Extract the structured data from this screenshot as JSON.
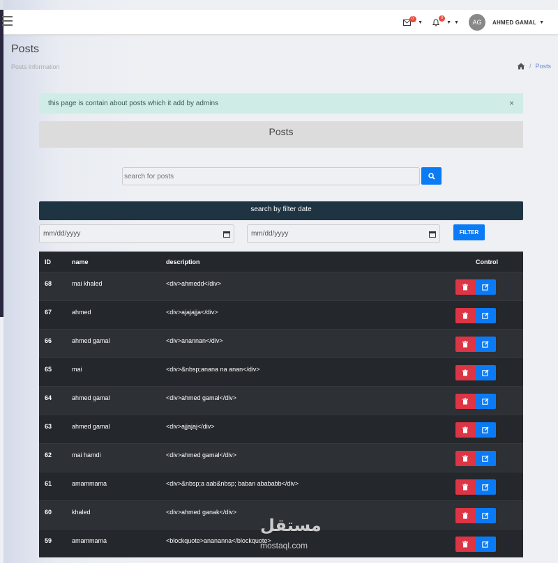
{
  "navbar": {
    "mail_badge": "0",
    "bell_badge": "0",
    "avatar_initials": "AG",
    "user_name": "AHMED GAMAL"
  },
  "page": {
    "title": "Posts",
    "subtitle": "Posts information",
    "breadcrumb_current": "Posts"
  },
  "alert": {
    "text": "this page is contain about posts which it add by admins",
    "close": "×"
  },
  "posts_header": "Posts",
  "search": {
    "placeholder": "search for posts"
  },
  "filter": {
    "bar_label": "search by filter date",
    "from_placeholder": "mm/dd/yyyy",
    "to_placeholder": "mm/dd/yyyy",
    "button_label": "FILTER"
  },
  "table": {
    "headers": {
      "id": "ID",
      "name": "name",
      "description": "description",
      "control": "Control"
    },
    "rows": [
      {
        "id": "68",
        "name": "mai khaled",
        "description": "<div>ahmedd</div>"
      },
      {
        "id": "67",
        "name": "ahmed",
        "description": "<div>ajajajja</div>"
      },
      {
        "id": "66",
        "name": "ahmed gamal",
        "description": "<div>anannan</div>"
      },
      {
        "id": "65",
        "name": "mai",
        "description": "<div>&nbsp;anana na anan</div>"
      },
      {
        "id": "64",
        "name": "ahmed gamal",
        "description": "<div>ahmed gamal</div>"
      },
      {
        "id": "63",
        "name": "ahmed gamal",
        "description": "<div>ajjajaj</div>"
      },
      {
        "id": "62",
        "name": "mai hamdi",
        "description": "<div>ahmed gamal</div>"
      },
      {
        "id": "61",
        "name": "amammama",
        "description": "<div>&nbsp;a aab&nbsp; baban abababb</div>"
      },
      {
        "id": "60",
        "name": "khaled",
        "description": "<div>ahmed ganak</div>"
      },
      {
        "id": "59",
        "name": "amammama",
        "description": "<blockquote>anananna</blockquote>"
      }
    ]
  },
  "watermark": {
    "arabic": "مستقل",
    "domain": "mostaql.com"
  },
  "colors": {
    "primary": "#0b7bf5",
    "danger": "#dc3545",
    "table_bg": "#26292e",
    "alert_bg": "#d0ece7",
    "filter_bar": "#1f3442"
  }
}
